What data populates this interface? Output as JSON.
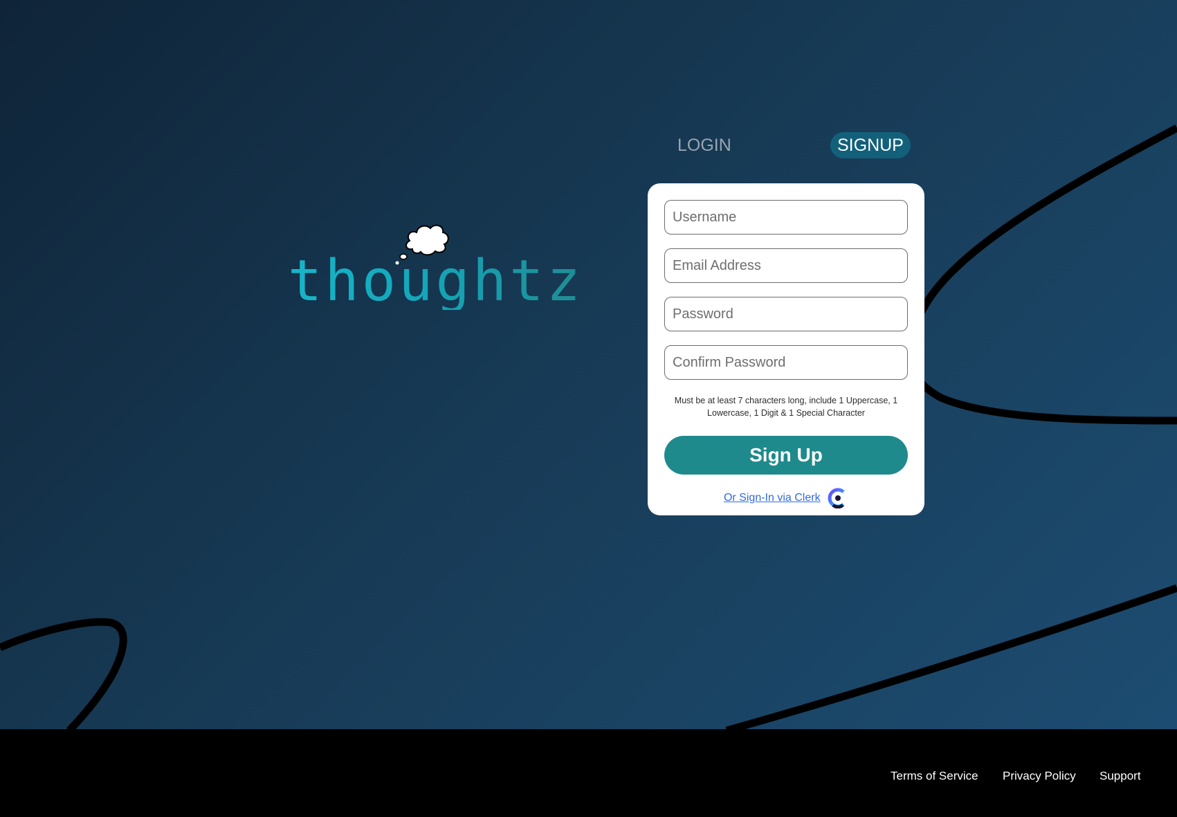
{
  "brand": {
    "name": "thoughtz",
    "logo_icon": "thought-cloud-icon"
  },
  "tabs": {
    "login_label": "LOGIN",
    "signup_label": "SIGNUP",
    "active": "signup"
  },
  "form": {
    "username_placeholder": "Username",
    "email_placeholder": "Email Address",
    "password_placeholder": "Password",
    "confirm_password_placeholder": "Confirm Password",
    "password_hint": "Must be at least 7 characters long, include 1 Uppercase, 1 Lowercase, 1 Digit & 1 Special Character",
    "submit_label": "Sign Up",
    "clerk_link_label": "Or Sign-In via Clerk",
    "clerk_icon": "clerk-logo-icon"
  },
  "footer": {
    "links": [
      "Terms of Service",
      "Privacy Policy",
      "Support"
    ]
  },
  "colors": {
    "background_start": "#0f2438",
    "background_end": "#1d4e74",
    "accent_teal": "#1f8a8c",
    "active_tab": "#13607a",
    "link_blue": "#2f6ae0"
  }
}
